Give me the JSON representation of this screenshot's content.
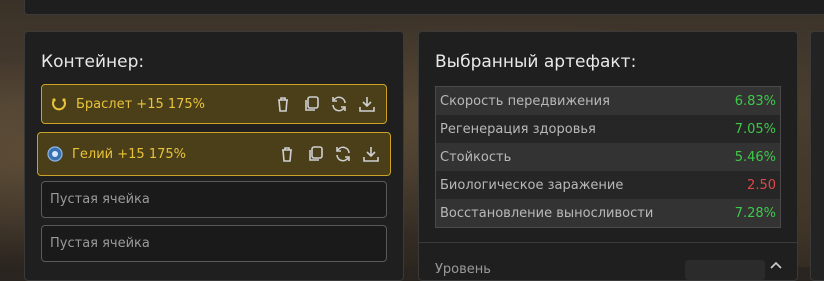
{
  "container": {
    "title": "Контейнер:",
    "cells": [
      {
        "type": "filled",
        "icon": "bracelet-icon",
        "label": "Браслет +15 175%"
      },
      {
        "type": "filled",
        "icon": "artifact-helium-icon",
        "label": "Гелий +15 175%"
      },
      {
        "type": "empty",
        "label": "Пустая ячейка"
      },
      {
        "type": "empty",
        "label": "Пустая ячейка"
      }
    ]
  },
  "artifact": {
    "title": "Выбранный артефакт:",
    "stats": [
      {
        "name": "Скорость передвижения",
        "value": "6.83%",
        "color": "#3fc94a"
      },
      {
        "name": "Регенерация здоровья",
        "value": "7.05%",
        "color": "#3fc94a"
      },
      {
        "name": "Стойкость",
        "value": "5.46%",
        "color": "#3fc94a"
      },
      {
        "name": "Биологическое заражение",
        "value": "2.50",
        "color": "#e04848"
      },
      {
        "name": "Восстановление выносливости",
        "value": "7.28%",
        "color": "#3fc94a"
      }
    ],
    "bottom_label": "Уровень"
  },
  "colors": {
    "accent_gold": "#c9a227",
    "positive": "#3fc94a",
    "negative": "#e04848"
  }
}
